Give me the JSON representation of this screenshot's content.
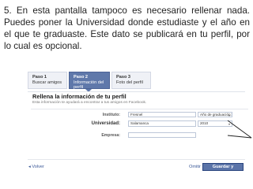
{
  "instruction": "5. En esta pantalla tampoco es necesario rellenar nada. Puedes poner la Universidad donde estudiaste y el año en el que te graduaste. Este dato se publicará en tu perfil, por lo cual es opcional.",
  "steps": [
    {
      "num": "Paso 1",
      "label": "Buscar amigos"
    },
    {
      "num": "Paso 2",
      "label": "Información del perfil"
    },
    {
      "num": "Paso 3",
      "label": "Foto del perfil"
    }
  ],
  "form": {
    "heading": "Rellena la información de tu perfil",
    "subheading": "Esta información te ayudará a encontrar a tus amigos en Facebook.",
    "fields": [
      {
        "label": "Instituto:",
        "value": "Fresnel"
      },
      {
        "label": "Universidad:",
        "value": "Salamanca"
      },
      {
        "label": "Empresa:",
        "value": ""
      }
    ],
    "year_select_1": "Año de graduación:",
    "year_select_2": "2010"
  },
  "footer": {
    "back": "◂ Volver",
    "skip": "Omitir",
    "save": "Guardar y continuar"
  },
  "colors": {
    "active_step": "#5f78aa",
    "button": "#5b74a8",
    "link": "#3b5998"
  }
}
